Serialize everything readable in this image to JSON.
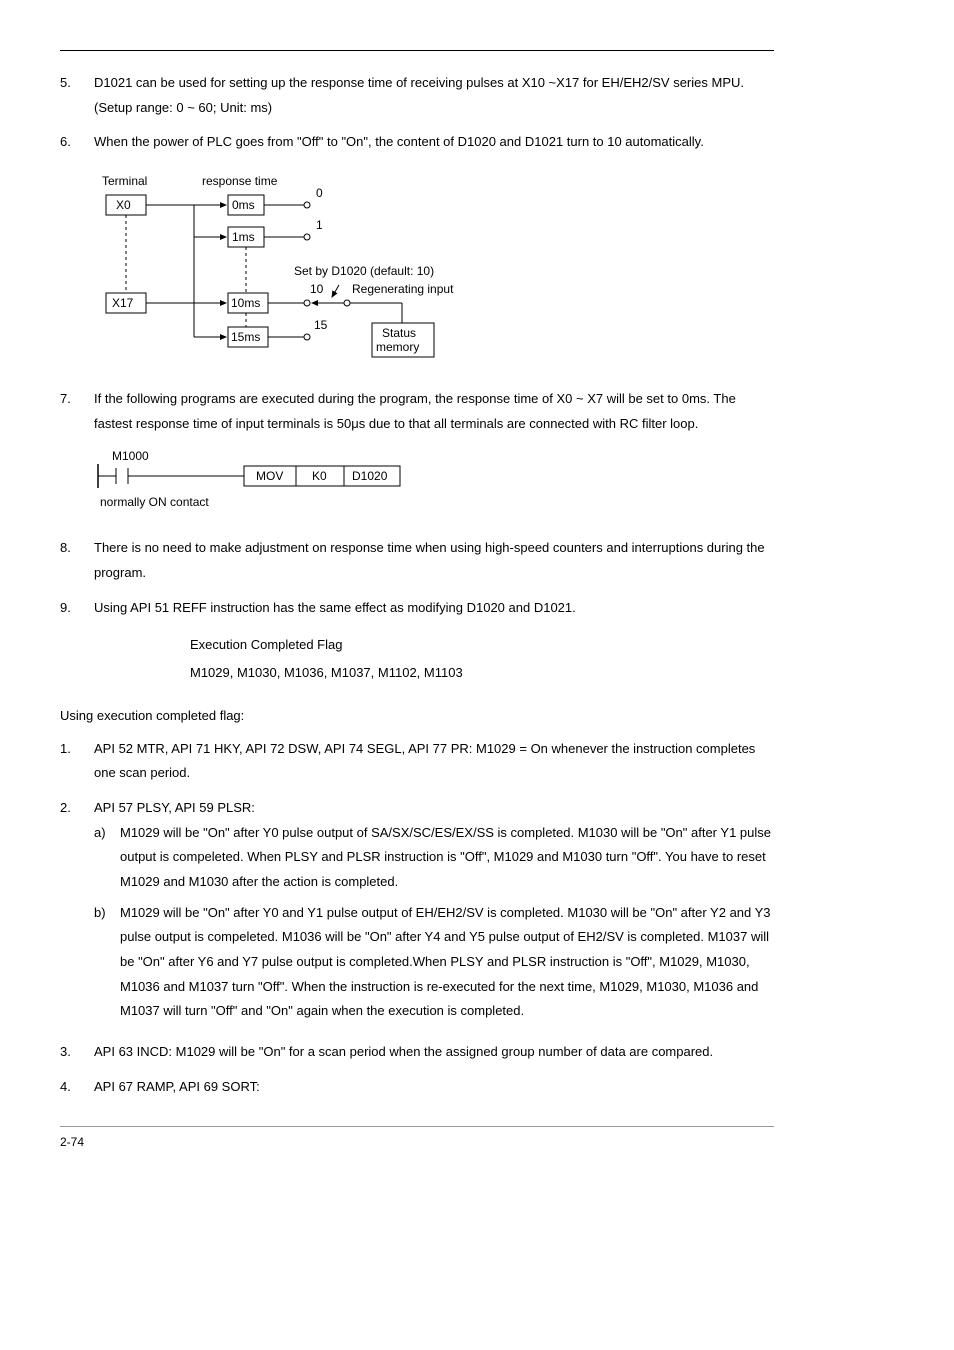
{
  "items": {
    "n5": "5.",
    "t5": "D1021 can be used for setting up the response time of receiving pulses at X10 ~X17 for EH/EH2/SV series MPU. (Setup range: 0 ~ 60; Unit: ms)",
    "n6": "6.",
    "t6": "When the power of PLC goes from \"Off\" to \"On\", the content of D1020 and D1021 turn to 10 automatically.",
    "n7": "7.",
    "t7": "If the following programs are executed during the program, the response time of X0 ~ X7 will be set to 0ms. The fastest response time of input terminals is 50μs due to that all terminals are connected with RC filter loop.",
    "n8": "8.",
    "t8": "There is no need to make adjustment on response time when using high-speed counters and interruptions during the program.",
    "n9": "9.",
    "t9": "Using API 51 REFF instruction has the same effect as modifying D1020 and D1021."
  },
  "diagram": {
    "terminal": "Terminal",
    "response": "response time",
    "x0": "X0",
    "x17": "X17",
    "ms0": "0ms",
    "ms1": "1ms",
    "ms10": "10ms",
    "ms15": "15ms",
    "v0": "0",
    "v1": "1",
    "v10": "10",
    "v15": "15",
    "setby": "Set by D1020 (default: 10)",
    "regen": "Regenerating input",
    "status1": "Status",
    "status2": "memory"
  },
  "ladder": {
    "m1000": "M1000",
    "mov": "MOV",
    "k0": "K0",
    "d1020": "D1020",
    "caption": "normally ON contact"
  },
  "center": {
    "line1": "Execution Completed Flag",
    "line2": "M1029, M1030, M1036, M1037, M1102, M1103"
  },
  "using": "Using execution completed flag:",
  "items2": {
    "n1": "1.",
    "t1": "API 52 MTR, API 71 HKY, API 72 DSW, API 74 SEGL, API 77 PR: M1029 = On whenever the instruction completes one scan period.",
    "n2": "2.",
    "t2": "API 57 PLSY, API 59 PLSR:",
    "a": "a)",
    "ta": "M1029 will be \"On\" after Y0 pulse output of SA/SX/SC/ES/EX/SS is completed. M1030 will be \"On\" after Y1 pulse output is compeleted. When PLSY and PLSR instruction is \"Off\", M1029 and M1030 turn \"Off\". You have to reset M1029 and M1030 after the action is completed.",
    "b": "b)",
    "tb": "M1029 will be \"On\" after Y0 and Y1 pulse output of EH/EH2/SV is completed. M1030 will be \"On\" after Y2 and Y3 pulse output is compeleted. M1036 will be \"On\" after Y4 and Y5 pulse output of EH2/SV is completed. M1037 will be \"On\" after Y6 and Y7 pulse output is completed.When PLSY and PLSR instruction is \"Off\", M1029, M1030, M1036 and M1037 turn \"Off\". When the instruction is re-executed for the next time, M1029, M1030, M1036 and M1037 will turn \"Off\" and \"On\" again when the execution is completed.",
    "n3": "3.",
    "t3": "API 63 INCD: M1029 will be \"On\" for a scan period when the assigned group number of data are compared.",
    "n4": "4.",
    "t4": "API 67 RAMP, API 69 SORT:"
  },
  "pagenum": "2-74"
}
